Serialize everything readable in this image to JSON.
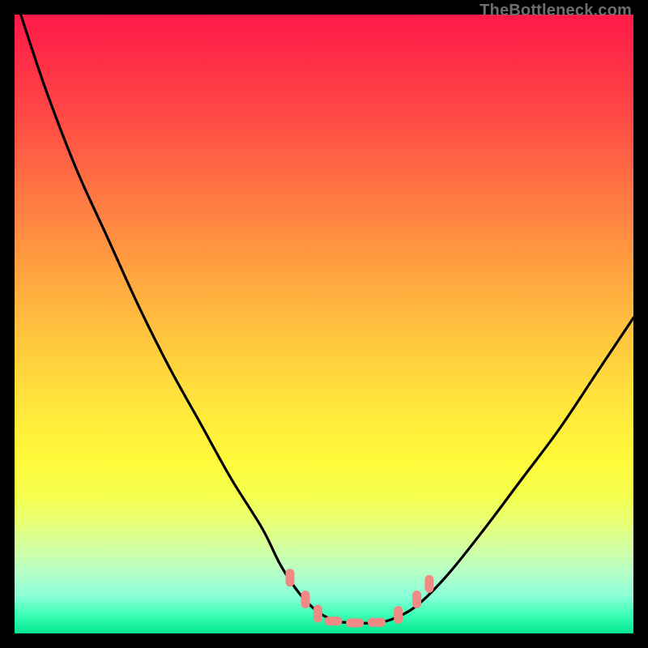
{
  "watermark": "TheBottleneck.com",
  "chart_data": {
    "type": "line",
    "title": "",
    "xlabel": "",
    "ylabel": "",
    "xlim": [
      0,
      100
    ],
    "ylim": [
      0,
      100
    ],
    "grid": false,
    "legend": false,
    "background_gradient": {
      "direction": "vertical",
      "stops": [
        {
          "pos": 0.0,
          "color": "#ff1a49"
        },
        {
          "pos": 0.5,
          "color": "#ffc83e"
        },
        {
          "pos": 0.78,
          "color": "#f4ff4f"
        },
        {
          "pos": 1.0,
          "color": "#00e68f"
        }
      ]
    },
    "series": [
      {
        "name": "bottleneck-curve",
        "color": "#000000",
        "x": [
          1,
          5,
          10,
          15,
          20,
          25,
          30,
          35,
          40,
          43,
          46,
          49,
          52,
          55,
          58,
          61,
          65,
          70,
          76,
          82,
          88,
          94,
          100
        ],
        "y": [
          100,
          88,
          75,
          64,
          53,
          43,
          34,
          25,
          17,
          11,
          6.5,
          3.5,
          2.0,
          1.7,
          1.7,
          2.3,
          4.5,
          9.5,
          17,
          25,
          33,
          42,
          51
        ]
      }
    ],
    "markers": [
      {
        "name": "marker",
        "color": "#f08a84",
        "shape": "pill",
        "x": 44.5,
        "y": 9.0
      },
      {
        "name": "marker",
        "color": "#f08a84",
        "shape": "pill",
        "x": 47.0,
        "y": 5.5
      },
      {
        "name": "marker",
        "color": "#f08a84",
        "shape": "pill",
        "x": 49.0,
        "y": 3.2
      },
      {
        "name": "marker",
        "color": "#f08a84",
        "shape": "pill-h",
        "x": 51.5,
        "y": 2.0
      },
      {
        "name": "marker",
        "color": "#f08a84",
        "shape": "pill-h",
        "x": 55.0,
        "y": 1.7
      },
      {
        "name": "marker",
        "color": "#f08a84",
        "shape": "pill-h",
        "x": 58.5,
        "y": 1.8
      },
      {
        "name": "marker",
        "color": "#f08a84",
        "shape": "pill",
        "x": 62.0,
        "y": 3.0
      },
      {
        "name": "marker",
        "color": "#f08a84",
        "shape": "pill",
        "x": 65.0,
        "y": 5.5
      },
      {
        "name": "marker",
        "color": "#f08a84",
        "shape": "pill",
        "x": 67.0,
        "y": 8.0
      }
    ]
  }
}
